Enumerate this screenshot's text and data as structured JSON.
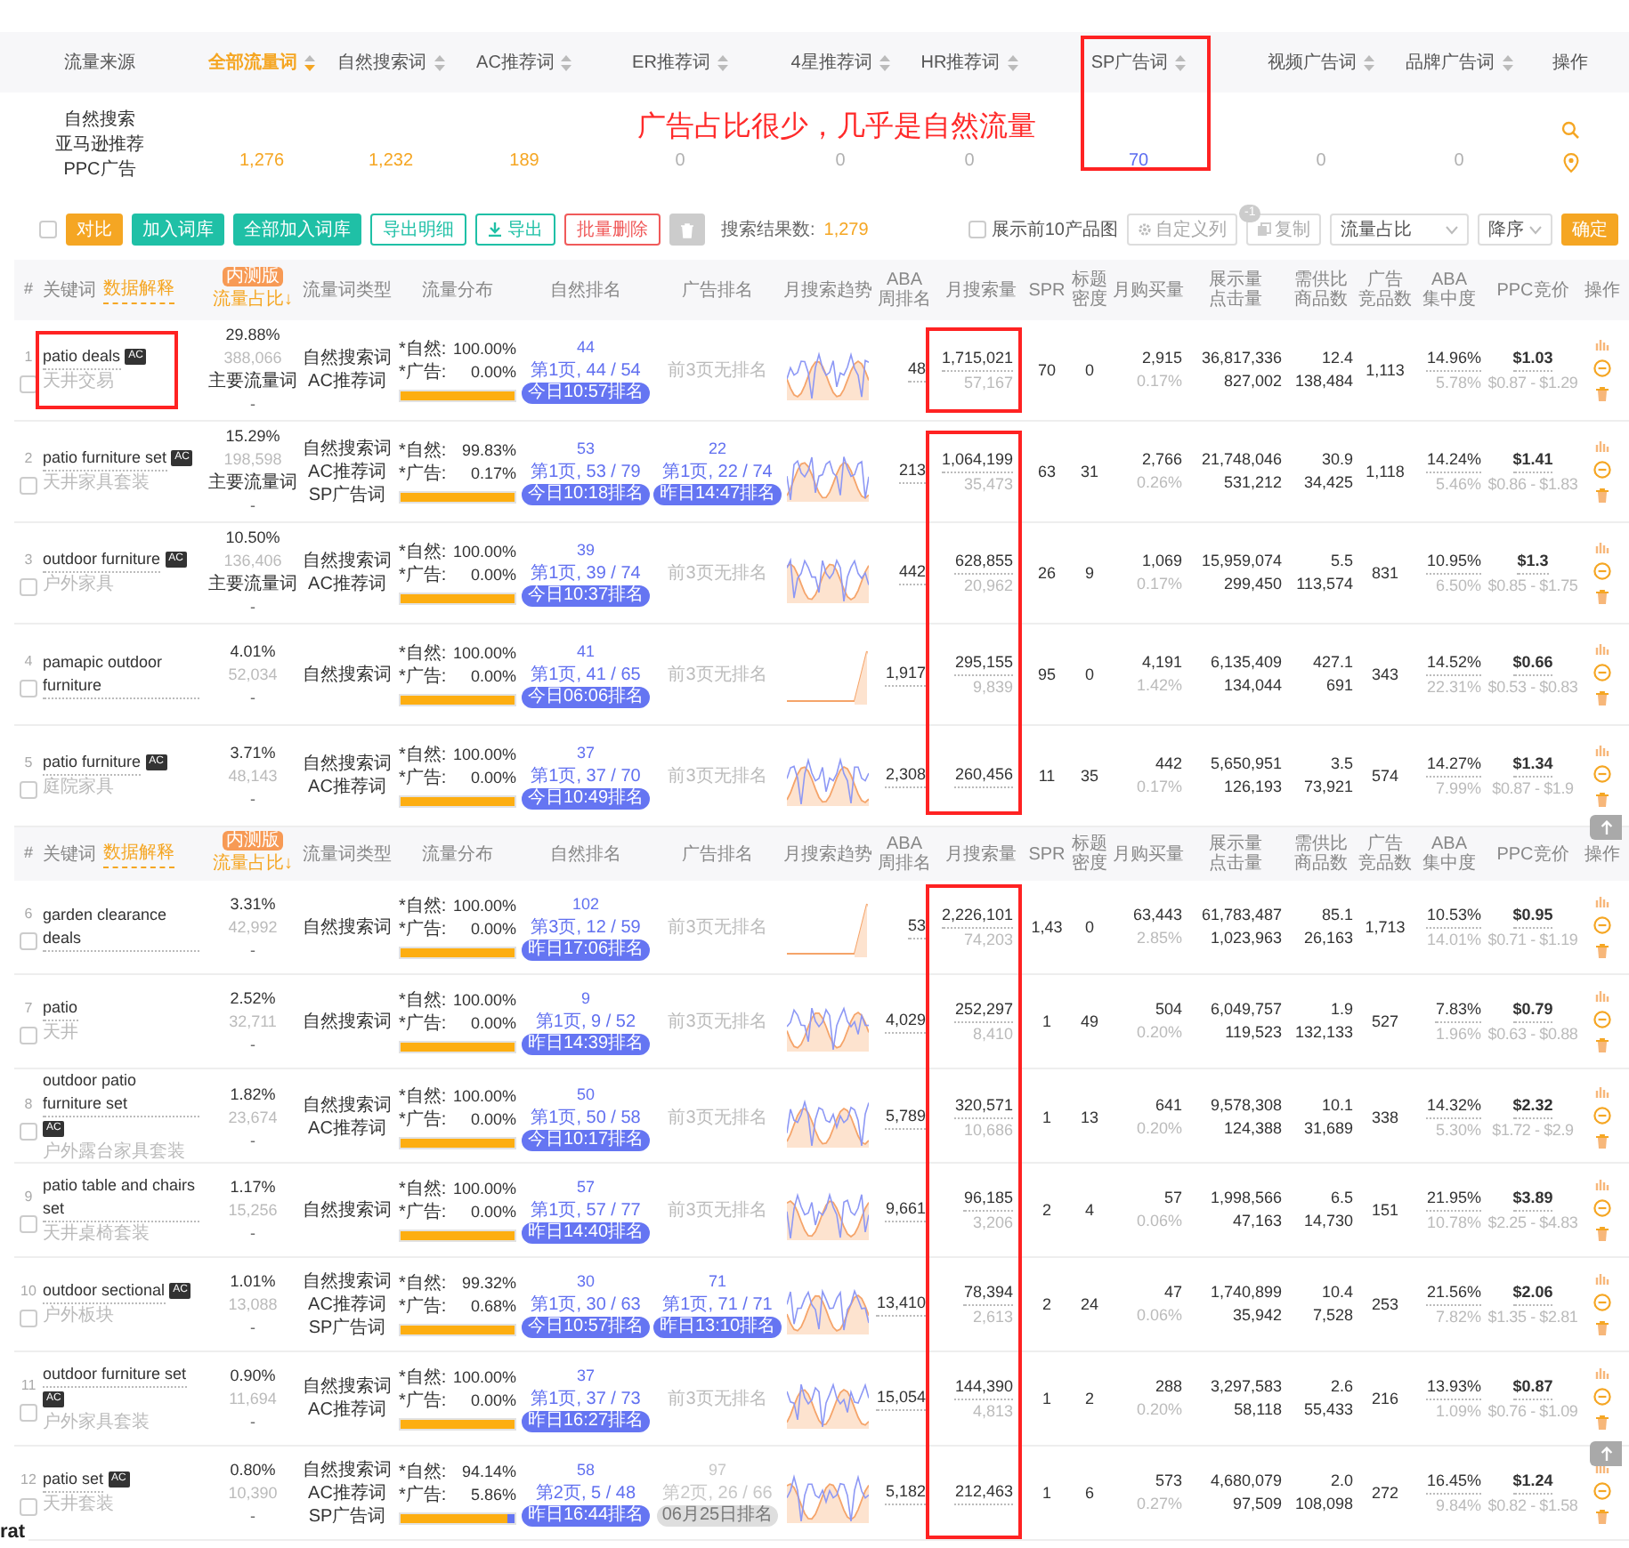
{
  "sources": {
    "label": "流量来源",
    "names": [
      "自然搜索",
      "亚马逊推荐",
      "PPC广告"
    ],
    "actions_label": "操作",
    "tabs": [
      {
        "label": "全部流量词",
        "selected": true,
        "value": "1,276",
        "color": "#f5a623"
      },
      {
        "label": "自然搜索词",
        "selected": false,
        "value": "1,232",
        "color": "#f5a623"
      },
      {
        "label": "AC推荐词",
        "selected": false,
        "value": "189",
        "color": "#f5a623"
      },
      {
        "label": "ER推荐词",
        "selected": false,
        "value": "0",
        "color": "#b0b0b0"
      },
      {
        "label": "4星推荐词",
        "selected": false,
        "value": "0",
        "color": "#b0b0b0"
      },
      {
        "label": "HR推荐词",
        "selected": false,
        "value": "0",
        "color": "#b0b0b0"
      },
      {
        "label": "SP广告词",
        "selected": false,
        "value": "70",
        "color": "#5b6cf0"
      },
      {
        "label": "视频广告词",
        "selected": false,
        "value": "0",
        "color": "#b0b0b0"
      },
      {
        "label": "品牌广告词",
        "selected": false,
        "value": "0",
        "color": "#b0b0b0"
      }
    ]
  },
  "annotation": "广告占比很少，几乎是自然流量",
  "toolbar": {
    "checked": false,
    "buttons": [
      {
        "label": "对比",
        "kind": "primary"
      },
      {
        "label": "加入词库",
        "kind": "teal"
      },
      {
        "label": "全部加入词库",
        "kind": "teal"
      },
      {
        "label": "导出明细",
        "kind": "outline"
      },
      {
        "label": "导出",
        "kind": "download"
      },
      {
        "label": "批量删除",
        "kind": "danger"
      },
      {
        "kind": "trash"
      }
    ],
    "result_label": "搜索结果数:",
    "result_count": "1,279",
    "show_images": {
      "label": "展示前10产品图",
      "checked": false
    },
    "custom_columns": {
      "label": "自定义列",
      "badge": "-1"
    },
    "copy": "复制",
    "sort_field": "流量占比",
    "sort_order": "降序",
    "confirm": "确定"
  },
  "tables": [
    {
      "header": {
        "index": "#",
        "keyword": "关键词",
        "explain": "数据解释",
        "beta": "内测版",
        "share": "流量占比↓",
        "columns": [
          [
            "流量词类型"
          ],
          [
            "流量分布"
          ],
          [
            "自然排名"
          ],
          [
            "广告排名"
          ],
          [
            "月搜索趋势"
          ],
          [
            "ABA",
            "周排名"
          ],
          [
            "月搜索量"
          ],
          [
            "SPR"
          ],
          [
            "标题",
            "密度"
          ],
          [
            "月购买量"
          ],
          [
            "展示量",
            "点击量"
          ],
          [
            "需供比",
            "商品数"
          ],
          [
            "广告",
            "竞品数"
          ],
          [
            "ABA",
            "集中度"
          ],
          [
            "PPC竞价"
          ],
          [
            "操作"
          ]
        ]
      },
      "rows": [
        {
          "no": "1",
          "checked": false,
          "keyword": "patio deals",
          "badge": "AC",
          "translation": "天井交易",
          "share": "29.88%",
          "share_count": "388,066",
          "share_tag": "主要流量词",
          "share_dash": "-",
          "types": [
            "自然搜索词",
            "AC推荐词"
          ],
          "dist": [
            "*自然:",
            "100.00%",
            "*广告:",
            "0.00%"
          ],
          "level": 1,
          "nat_rank": {
            "rank": "44",
            "page": "第1页, 44 / 54",
            "time": "今日10:57排名"
          },
          "ad_rank": {
            "kind": "none",
            "text": "前3页无排名"
          },
          "trend": {
            "kind": "wave"
          },
          "aba_rank": "48",
          "volume": "1,715,021",
          "volume_sub": "57,167",
          "spr": "70",
          "density": "0",
          "purchases": "2,915",
          "purchase_rate": "0.17%",
          "impressions": "36,817,336",
          "clicks": "827,002",
          "supply_ratio": "12.4",
          "products": "138,484",
          "ad_products": "1,113",
          "concentration": "14.96%",
          "concentration_sub": "5.78%",
          "ppc": "$1.03",
          "ppc_range": "$0.87 - $1.29"
        },
        {
          "no": "2",
          "checked": false,
          "keyword": "patio furniture set",
          "badge": "AC",
          "translation": "天井家具套装",
          "share": "15.29%",
          "share_count": "198,598",
          "share_tag": "主要流量词",
          "share_dash": "-",
          "types": [
            "自然搜索词",
            "AC推荐词",
            "SP广告词"
          ],
          "dist": [
            "*自然:",
            "99.83%",
            "*广告:",
            "0.17%"
          ],
          "level": 0.9983,
          "nat_rank": {
            "rank": "53",
            "page": "第1页, 53 / 79",
            "time": "今日10:18排名"
          },
          "ad_rank": {
            "kind": "rank",
            "rank": "22",
            "page": "第1页, 22 / 74",
            "time": "昨日14:47排名"
          },
          "trend": {
            "kind": "wave"
          },
          "aba_rank": "213",
          "volume": "1,064,199",
          "volume_sub": "35,473",
          "spr": "63",
          "density": "31",
          "purchases": "2,766",
          "purchase_rate": "0.26%",
          "impressions": "21,748,046",
          "clicks": "531,212",
          "supply_ratio": "30.9",
          "products": "34,425",
          "ad_products": "1,118",
          "concentration": "14.24%",
          "concentration_sub": "5.46%",
          "ppc": "$1.41",
          "ppc_range": "$0.86 - $1.83"
        },
        {
          "no": "3",
          "checked": false,
          "keyword": "outdoor furniture",
          "badge": "AC",
          "translation": "户外家具",
          "share": "10.50%",
          "share_count": "136,406",
          "share_tag": "主要流量词",
          "share_dash": "-",
          "types": [
            "自然搜索词",
            "AC推荐词"
          ],
          "dist": [
            "*自然:",
            "100.00%",
            "*广告:",
            "0.00%"
          ],
          "level": 1,
          "nat_rank": {
            "rank": "39",
            "page": "第1页, 39 / 74",
            "time": "今日10:37排名"
          },
          "ad_rank": {
            "kind": "none",
            "text": "前3页无排名"
          },
          "trend": {
            "kind": "wave"
          },
          "aba_rank": "442",
          "volume": "628,855",
          "volume_sub": "20,962",
          "spr": "26",
          "density": "9",
          "purchases": "1,069",
          "purchase_rate": "0.17%",
          "impressions": "15,959,074",
          "clicks": "299,450",
          "supply_ratio": "5.5",
          "products": "113,574",
          "ad_products": "831",
          "concentration": "10.95%",
          "concentration_sub": "6.50%",
          "ppc": "$1.3",
          "ppc_range": "$0.85 - $1.75"
        },
        {
          "no": "4",
          "checked": false,
          "keyword": "pamapic outdoor furniture",
          "share": "4.01%",
          "share_count": "52,034",
          "share_dash": "-",
          "types": [
            "自然搜索词"
          ],
          "dist": [
            "*自然:",
            "100.00%",
            "*广告:",
            "0.00%"
          ],
          "level": 1,
          "nat_rank": {
            "rank": "41",
            "page": "第1页, 41 / 65",
            "time": "今日06:06排名"
          },
          "ad_rank": {
            "kind": "none",
            "text": "前3页无排名"
          },
          "trend": {
            "kind": "rising"
          },
          "aba_rank": "1,917",
          "volume": "295,155",
          "volume_sub": "9,839",
          "spr": "95",
          "density": "0",
          "purchases": "4,191",
          "purchase_rate": "1.42%",
          "impressions": "6,135,409",
          "clicks": "134,044",
          "supply_ratio": "427.1",
          "products": "691",
          "ad_products": "343",
          "concentration": "14.52%",
          "concentration_sub": "22.31%",
          "ppc": "$0.66",
          "ppc_range": "$0.53 - $0.83"
        },
        {
          "no": "5",
          "checked": false,
          "keyword": "patio furniture",
          "badge": "AC",
          "translation": "庭院家具",
          "share": "3.71%",
          "share_count": "48,143",
          "share_dash": "-",
          "types": [
            "自然搜索词",
            "AC推荐词"
          ],
          "dist": [
            "*自然:",
            "100.00%",
            "*广告:",
            "0.00%"
          ],
          "level": 1,
          "nat_rank": {
            "rank": "37",
            "page": "第1页, 37 / 70",
            "time": "今日10:49排名"
          },
          "ad_rank": {
            "kind": "none",
            "text": "前3页无排名"
          },
          "trend": {
            "kind": "wave"
          },
          "aba_rank": "2,308",
          "volume": "260,456",
          "spr": "11",
          "density": "35",
          "purchases": "442",
          "purchase_rate": "0.17%",
          "impressions": "5,650,951",
          "clicks": "126,193",
          "supply_ratio": "3.5",
          "products": "73,921",
          "ad_products": "574",
          "concentration": "14.27%",
          "concentration_sub": "7.99%",
          "ppc": "$1.34",
          "ppc_range": "$0.87 - $1.9"
        }
      ]
    },
    {
      "header": {
        "index": "#",
        "keyword": "关键词",
        "explain": "数据解释",
        "beta": "内测版",
        "share": "流量占比↓",
        "columns": [
          [
            "流量词类型"
          ],
          [
            "流量分布"
          ],
          [
            "自然排名"
          ],
          [
            "广告排名"
          ],
          [
            "月搜索趋势"
          ],
          [
            "ABA",
            "周排名"
          ],
          [
            "月搜索量"
          ],
          [
            "SPR"
          ],
          [
            "标题",
            "密度"
          ],
          [
            "月购买量"
          ],
          [
            "展示量",
            "点击量"
          ],
          [
            "需供比",
            "商品数"
          ],
          [
            "广告",
            "竞品数"
          ],
          [
            "ABA",
            "集中度"
          ],
          [
            "PPC竞价"
          ],
          [
            "操作"
          ]
        ]
      },
      "rows": [
        {
          "no": "6",
          "checked": false,
          "keyword": "garden clearance deals",
          "share": "3.31%",
          "share_count": "42,992",
          "share_dash": "-",
          "types": [
            "自然搜索词"
          ],
          "dist": [
            "*自然:",
            "100.00%",
            "*广告:",
            "0.00%"
          ],
          "level": 1,
          "nat_rank": {
            "rank": "102",
            "page": "第3页, 12 / 59",
            "time": "昨日17:06排名"
          },
          "ad_rank": {
            "kind": "none",
            "text": "前3页无排名"
          },
          "trend": {
            "kind": "rising"
          },
          "aba_rank": "53",
          "volume": "2,226,101",
          "volume_sub": "74,203",
          "spr": "1,43",
          "density": "0",
          "purchases": "63,443",
          "purchase_rate": "2.85%",
          "impressions": "61,783,487",
          "clicks": "1,023,963",
          "supply_ratio": "85.1",
          "products": "26,163",
          "ad_products": "1,713",
          "concentration": "10.53%",
          "concentration_sub": "14.01%",
          "ppc": "$0.95",
          "ppc_range": "$0.71 - $1.19"
        },
        {
          "no": "7",
          "checked": false,
          "keyword": "patio",
          "translation": "天井",
          "share": "2.52%",
          "share_count": "32,711",
          "share_dash": "-",
          "types": [
            "自然搜索词"
          ],
          "dist": [
            "*自然:",
            "100.00%",
            "*广告:",
            "0.00%"
          ],
          "level": 1,
          "nat_rank": {
            "rank": "9",
            "page": "第1页, 9 / 52",
            "time": "昨日14:39排名"
          },
          "ad_rank": {
            "kind": "none",
            "text": "前3页无排名"
          },
          "trend": {
            "kind": "wave"
          },
          "aba_rank": "4,029",
          "volume": "252,297",
          "volume_sub": "8,410",
          "spr": "1",
          "density": "49",
          "purchases": "504",
          "purchase_rate": "0.20%",
          "impressions": "6,049,757",
          "clicks": "119,523",
          "supply_ratio": "1.9",
          "products": "132,133",
          "ad_products": "527",
          "concentration": "7.83%",
          "concentration_sub": "1.96%",
          "ppc": "$0.79",
          "ppc_range": "$0.63 - $0.88"
        },
        {
          "no": "8",
          "checked": false,
          "keyword": "outdoor patio furniture set",
          "badge": "AC",
          "translation": "户外露台家具套装",
          "share": "1.82%",
          "share_count": "23,674",
          "share_dash": "-",
          "types": [
            "自然搜索词",
            "AC推荐词"
          ],
          "dist": [
            "*自然:",
            "100.00%",
            "*广告:",
            "0.00%"
          ],
          "level": 1,
          "nat_rank": {
            "rank": "50",
            "page": "第1页, 50 / 58",
            "time": "今日10:17排名"
          },
          "ad_rank": {
            "kind": "none",
            "text": "前3页无排名"
          },
          "trend": {
            "kind": "wave"
          },
          "aba_rank": "5,789",
          "volume": "320,571",
          "volume_sub": "10,686",
          "spr": "1",
          "density": "13",
          "purchases": "641",
          "purchase_rate": "0.20%",
          "impressions": "9,578,308",
          "clicks": "124,388",
          "supply_ratio": "10.1",
          "products": "31,689",
          "ad_products": "338",
          "concentration": "14.32%",
          "concentration_sub": "5.30%",
          "ppc": "$2.32",
          "ppc_range": "$1.72 - $2.9"
        },
        {
          "no": "9",
          "checked": false,
          "keyword": "patio table and chairs set",
          "translation": "天井桌椅套装",
          "share": "1.17%",
          "share_count": "15,256",
          "share_dash": "-",
          "types": [
            "自然搜索词"
          ],
          "dist": [
            "*自然:",
            "100.00%",
            "*广告:",
            "0.00%"
          ],
          "level": 1,
          "nat_rank": {
            "rank": "57",
            "page": "第1页, 57 / 77",
            "time": "昨日14:40排名"
          },
          "ad_rank": {
            "kind": "none",
            "text": "前3页无排名"
          },
          "trend": {
            "kind": "wave"
          },
          "aba_rank": "9,661",
          "volume": "96,185",
          "volume_sub": "3,206",
          "spr": "2",
          "density": "4",
          "purchases": "57",
          "purchase_rate": "0.06%",
          "impressions": "1,998,566",
          "clicks": "47,163",
          "supply_ratio": "6.5",
          "products": "14,730",
          "ad_products": "151",
          "concentration": "21.95%",
          "concentration_sub": "10.78%",
          "ppc": "$3.89",
          "ppc_range": "$2.25 - $4.83"
        },
        {
          "no": "10",
          "checked": false,
          "keyword": "outdoor sectional",
          "badge": "AC",
          "translation": "户外板块",
          "share": "1.01%",
          "share_count": "13,088",
          "share_dash": "-",
          "types": [
            "自然搜索词",
            "AC推荐词",
            "SP广告词"
          ],
          "dist": [
            "*自然:",
            "99.32%",
            "*广告:",
            "0.68%"
          ],
          "level": 0.9932,
          "nat_rank": {
            "rank": "30",
            "page": "第1页, 30 / 63",
            "time": "今日10:57排名"
          },
          "ad_rank": {
            "kind": "rank",
            "rank": "71",
            "page": "第1页, 71 / 71",
            "time": "昨日13:10排名"
          },
          "trend": {
            "kind": "wave"
          },
          "aba_rank": "13,410",
          "volume": "78,394",
          "volume_sub": "2,613",
          "spr": "2",
          "density": "24",
          "purchases": "47",
          "purchase_rate": "0.06%",
          "impressions": "1,740,899",
          "clicks": "35,942",
          "supply_ratio": "10.4",
          "products": "7,528",
          "ad_products": "253",
          "concentration": "21.56%",
          "concentration_sub": "7.82%",
          "ppc": "$2.06",
          "ppc_range": "$1.35 - $2.81"
        },
        {
          "no": "11",
          "checked": false,
          "keyword": "outdoor furniture set",
          "badge": "AC",
          "translation": "户外家具套装",
          "share": "0.90%",
          "share_count": "11,694",
          "share_dash": "-",
          "types": [
            "自然搜索词",
            "AC推荐词"
          ],
          "dist": [
            "*自然:",
            "100.00%",
            "*广告:",
            "0.00%"
          ],
          "level": 1,
          "nat_rank": {
            "rank": "37",
            "page": "第1页, 37 / 73",
            "time": "昨日16:27排名"
          },
          "ad_rank": {
            "kind": "none",
            "text": "前3页无排名"
          },
          "trend": {
            "kind": "wave"
          },
          "aba_rank": "15,054",
          "volume": "144,390",
          "volume_sub": "4,813",
          "spr": "1",
          "density": "2",
          "purchases": "288",
          "purchase_rate": "0.20%",
          "impressions": "3,297,583",
          "clicks": "58,118",
          "supply_ratio": "2.6",
          "products": "55,433",
          "ad_products": "216",
          "concentration": "13.93%",
          "concentration_sub": "1.09%",
          "ppc": "$0.87",
          "ppc_range": "$0.76 - $1.09"
        },
        {
          "no": "12",
          "checked": false,
          "keyword": "patio set",
          "badge": "AC",
          "translation": "天井套装",
          "share": "0.80%",
          "share_count": "10,390",
          "share_dash": "-",
          "types": [
            "自然搜索词",
            "AC推荐词",
            "SP广告词"
          ],
          "dist": [
            "*自然:",
            "94.14%",
            "*广告:",
            "5.86%"
          ],
          "level": 0.9414,
          "nat_rank": {
            "rank": "58",
            "page": "第2页, 5 / 48",
            "time": "昨日16:44排名"
          },
          "ad_rank": {
            "kind": "stale",
            "rank": "97",
            "page": "第2页, 26 / 66",
            "time": "06月25日排名"
          },
          "trend": {
            "kind": "wave"
          },
          "aba_rank": "5,182",
          "volume": "212,463",
          "spr": "1",
          "density": "6",
          "purchases": "573",
          "purchase_rate": "0.27%",
          "impressions": "4,680,079",
          "clicks": "97,509",
          "supply_ratio": "2.0",
          "products": "108,098",
          "ad_products": "272",
          "concentration": "16.45%",
          "concentration_sub": "9.84%",
          "ppc": "$1.24",
          "ppc_range": "$0.82 - $1.58"
        }
      ]
    }
  ],
  "edge_fragment": "rat"
}
